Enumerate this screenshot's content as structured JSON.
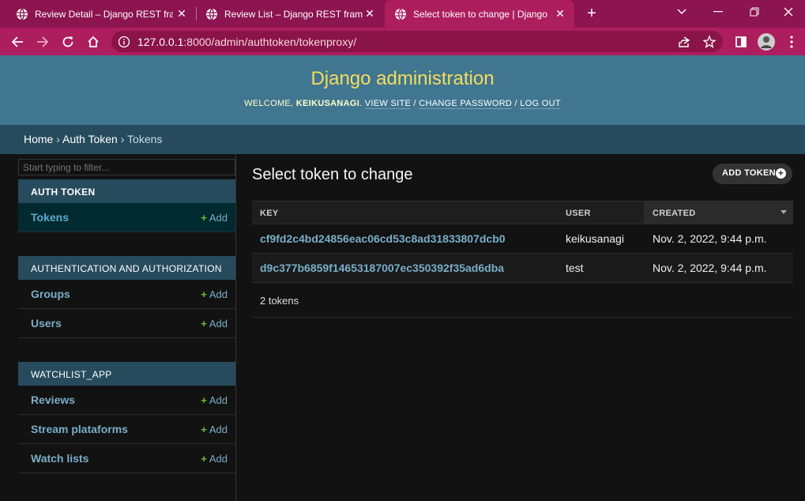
{
  "browser": {
    "tabs": [
      {
        "title": "Review Detail – Django REST fram",
        "active": false
      },
      {
        "title": "Review List – Django REST framew",
        "active": false
      },
      {
        "title": "Select token to change | Django",
        "active": true
      }
    ],
    "address": {
      "host": "127.0.0.1",
      "path": ":8000/admin/authtoken/tokenproxy/"
    },
    "colors": {
      "frame": "#8c1450",
      "toolbar": "#ad1e5e"
    }
  },
  "header": {
    "branding": "Django administration",
    "welcome": "WELCOME,",
    "username": "KEIKUSANAGI",
    "view_site": "VIEW SITE",
    "change_password": "CHANGE PASSWORD",
    "log_out": "LOG OUT"
  },
  "breadcrumbs": {
    "home": "Home",
    "app": "Auth Token",
    "current": "Tokens"
  },
  "sidebar": {
    "filter_placeholder": "Start typing to filter...",
    "add_label": "Add",
    "modules": [
      {
        "caption": "AUTH TOKEN",
        "models": [
          {
            "name": "Tokens",
            "current": true
          }
        ]
      },
      {
        "caption": "AUTHENTICATION AND AUTHORIZATION",
        "models": [
          {
            "name": "Groups"
          },
          {
            "name": "Users"
          }
        ]
      },
      {
        "caption": "WATCHLIST_APP",
        "models": [
          {
            "name": "Reviews"
          },
          {
            "name": "Stream plataforms"
          },
          {
            "name": "Watch lists"
          }
        ]
      }
    ]
  },
  "content": {
    "title": "Select token to change",
    "add_button": "ADD TOKEN",
    "columns": {
      "key": "KEY",
      "user": "USER",
      "created": "CREATED"
    },
    "rows": [
      {
        "key": "cf9fd2c4bd24856eac06cd53c8ad31833807dcb0",
        "user": "keikusanagi",
        "created": "Nov. 2, 2022, 9:44 p.m."
      },
      {
        "key": "d9c377b6859f14653187007ec350392f35ad6dba",
        "user": "test",
        "created": "Nov. 2, 2022, 9:44 p.m."
      }
    ],
    "count": "2 tokens"
  }
}
